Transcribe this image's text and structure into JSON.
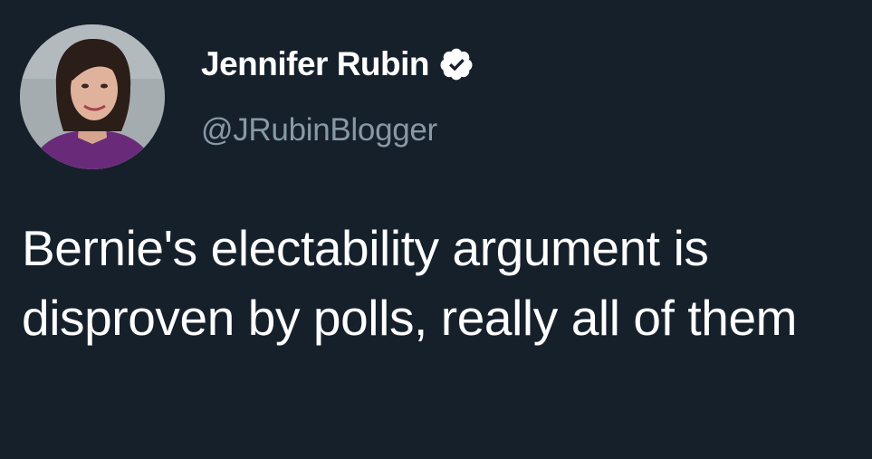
{
  "tweet": {
    "author_name": "Jennifer Rubin",
    "handle": "@JRubinBlogger",
    "verified": true,
    "text": "Bernie's electability argument is disproven by polls, really all of them"
  },
  "icons": {
    "verified": "verified-badge-icon",
    "avatar": "profile-photo"
  },
  "colors": {
    "background": "#15202b",
    "name": "#ffffff",
    "handle": "#8899a6",
    "text": "#ffffff",
    "badge": "#ffffff"
  }
}
